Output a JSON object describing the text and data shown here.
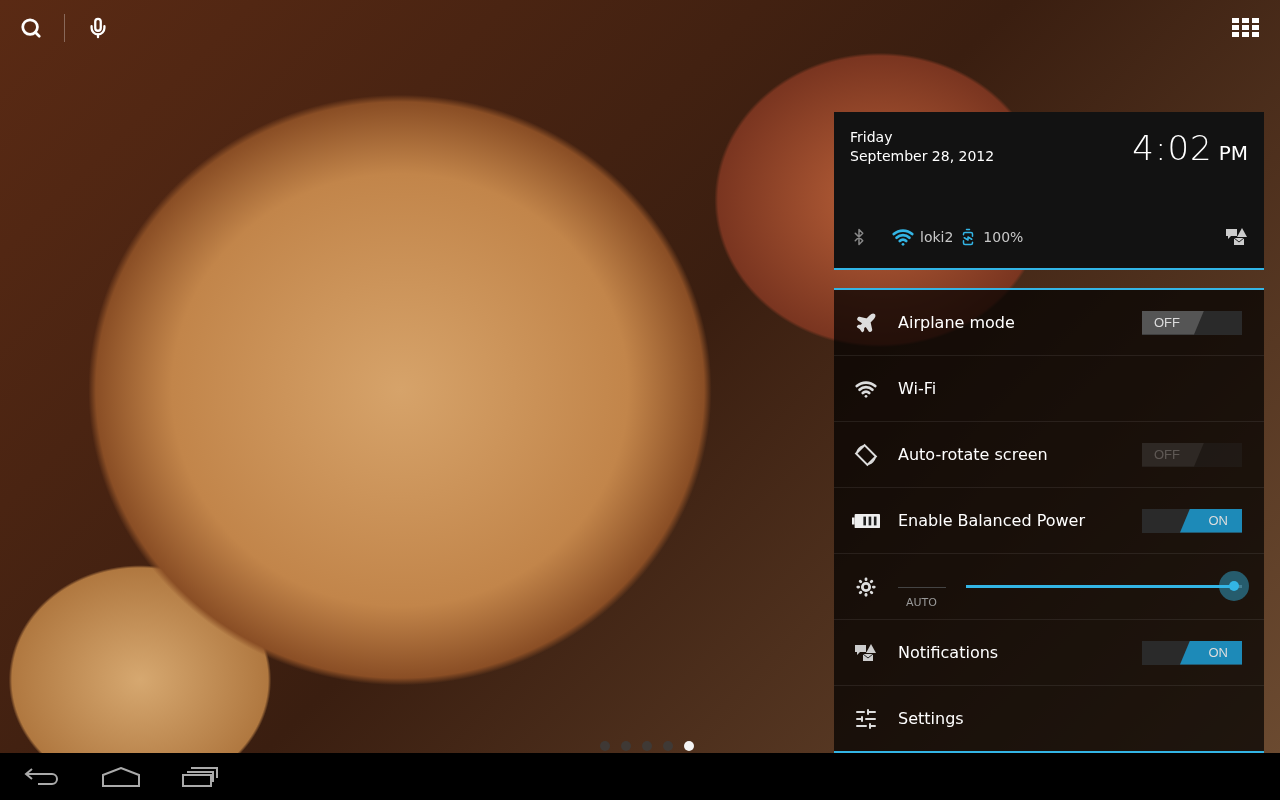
{
  "panel": {
    "day": "Friday",
    "date": "September 28, 2012",
    "time": "4:02",
    "ampm": "PM",
    "network": "loki2",
    "battery": "100%",
    "rows": [
      {
        "kind": "toggle",
        "label": "Airplane mode",
        "on": false,
        "disabled": false,
        "state_text": "OFF"
      },
      {
        "kind": "plain",
        "label": "Wi-Fi"
      },
      {
        "kind": "toggle",
        "label": "Auto-rotate screen",
        "on": false,
        "disabled": true,
        "state_text": "OFF"
      },
      {
        "kind": "toggle",
        "label": "Enable Balanced Power",
        "on": true,
        "disabled": false,
        "state_text": "ON"
      },
      {
        "kind": "slider",
        "auto": "AUTO",
        "level": 0.97
      },
      {
        "kind": "toggle",
        "label": "Notifications",
        "on": true,
        "disabled": false,
        "state_text": "ON"
      },
      {
        "kind": "plain",
        "label": "Settings"
      }
    ]
  },
  "page_dots": [
    {
      "selected": false
    },
    {
      "selected": false
    },
    {
      "selected": false
    },
    {
      "selected": false
    },
    {
      "selected": true
    }
  ]
}
